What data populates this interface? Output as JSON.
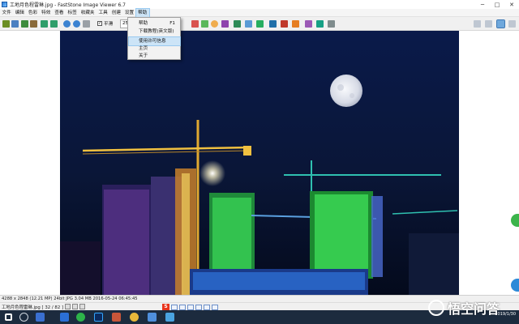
{
  "window": {
    "title": "工地月色程雷琳.jpg  -  FastStone Image Viewer 6.7",
    "min_glyph": "─",
    "max_glyph": "□",
    "close_glyph": "✕"
  },
  "menu": {
    "items": [
      "文件",
      "编辑",
      "色彩",
      "特效",
      "查看",
      "标签",
      "收藏夹",
      "工具",
      "创建",
      "设置",
      "帮助"
    ],
    "active_index": 10
  },
  "toolbar": {
    "zoom_value": "25%",
    "smooth_label": "平滑",
    "smooth_checked": true
  },
  "help_menu": {
    "items": [
      {
        "label": "帮助",
        "shortcut": "F1"
      },
      {
        "label": "下载教程(英文版)",
        "shortcut": ""
      },
      {
        "label": "使用许可信息",
        "shortcut": ""
      },
      {
        "label": "主页",
        "shortcut": ""
      },
      {
        "label": "关于",
        "shortcut": ""
      }
    ],
    "hover_index": 2
  },
  "status": {
    "info": "4288 x 2848 (12.21 MP)  24bit  JPG   3.04 MB    2016-05-24 06:45:45"
  },
  "file": {
    "name": "工地月色程雷琳.jpg [ 32 / 82 ]"
  },
  "ime": {
    "logo": "S"
  },
  "taskbar": {
    "time": "",
    "date": "2019/1/30"
  },
  "watermark": {
    "text": "悟空问答"
  },
  "colors": {
    "sky": "#0a1637",
    "moon": "#e9edf5",
    "crane": "#f0c040",
    "building_green": "#3fe05a",
    "taskbar": "#1c2b3e"
  }
}
